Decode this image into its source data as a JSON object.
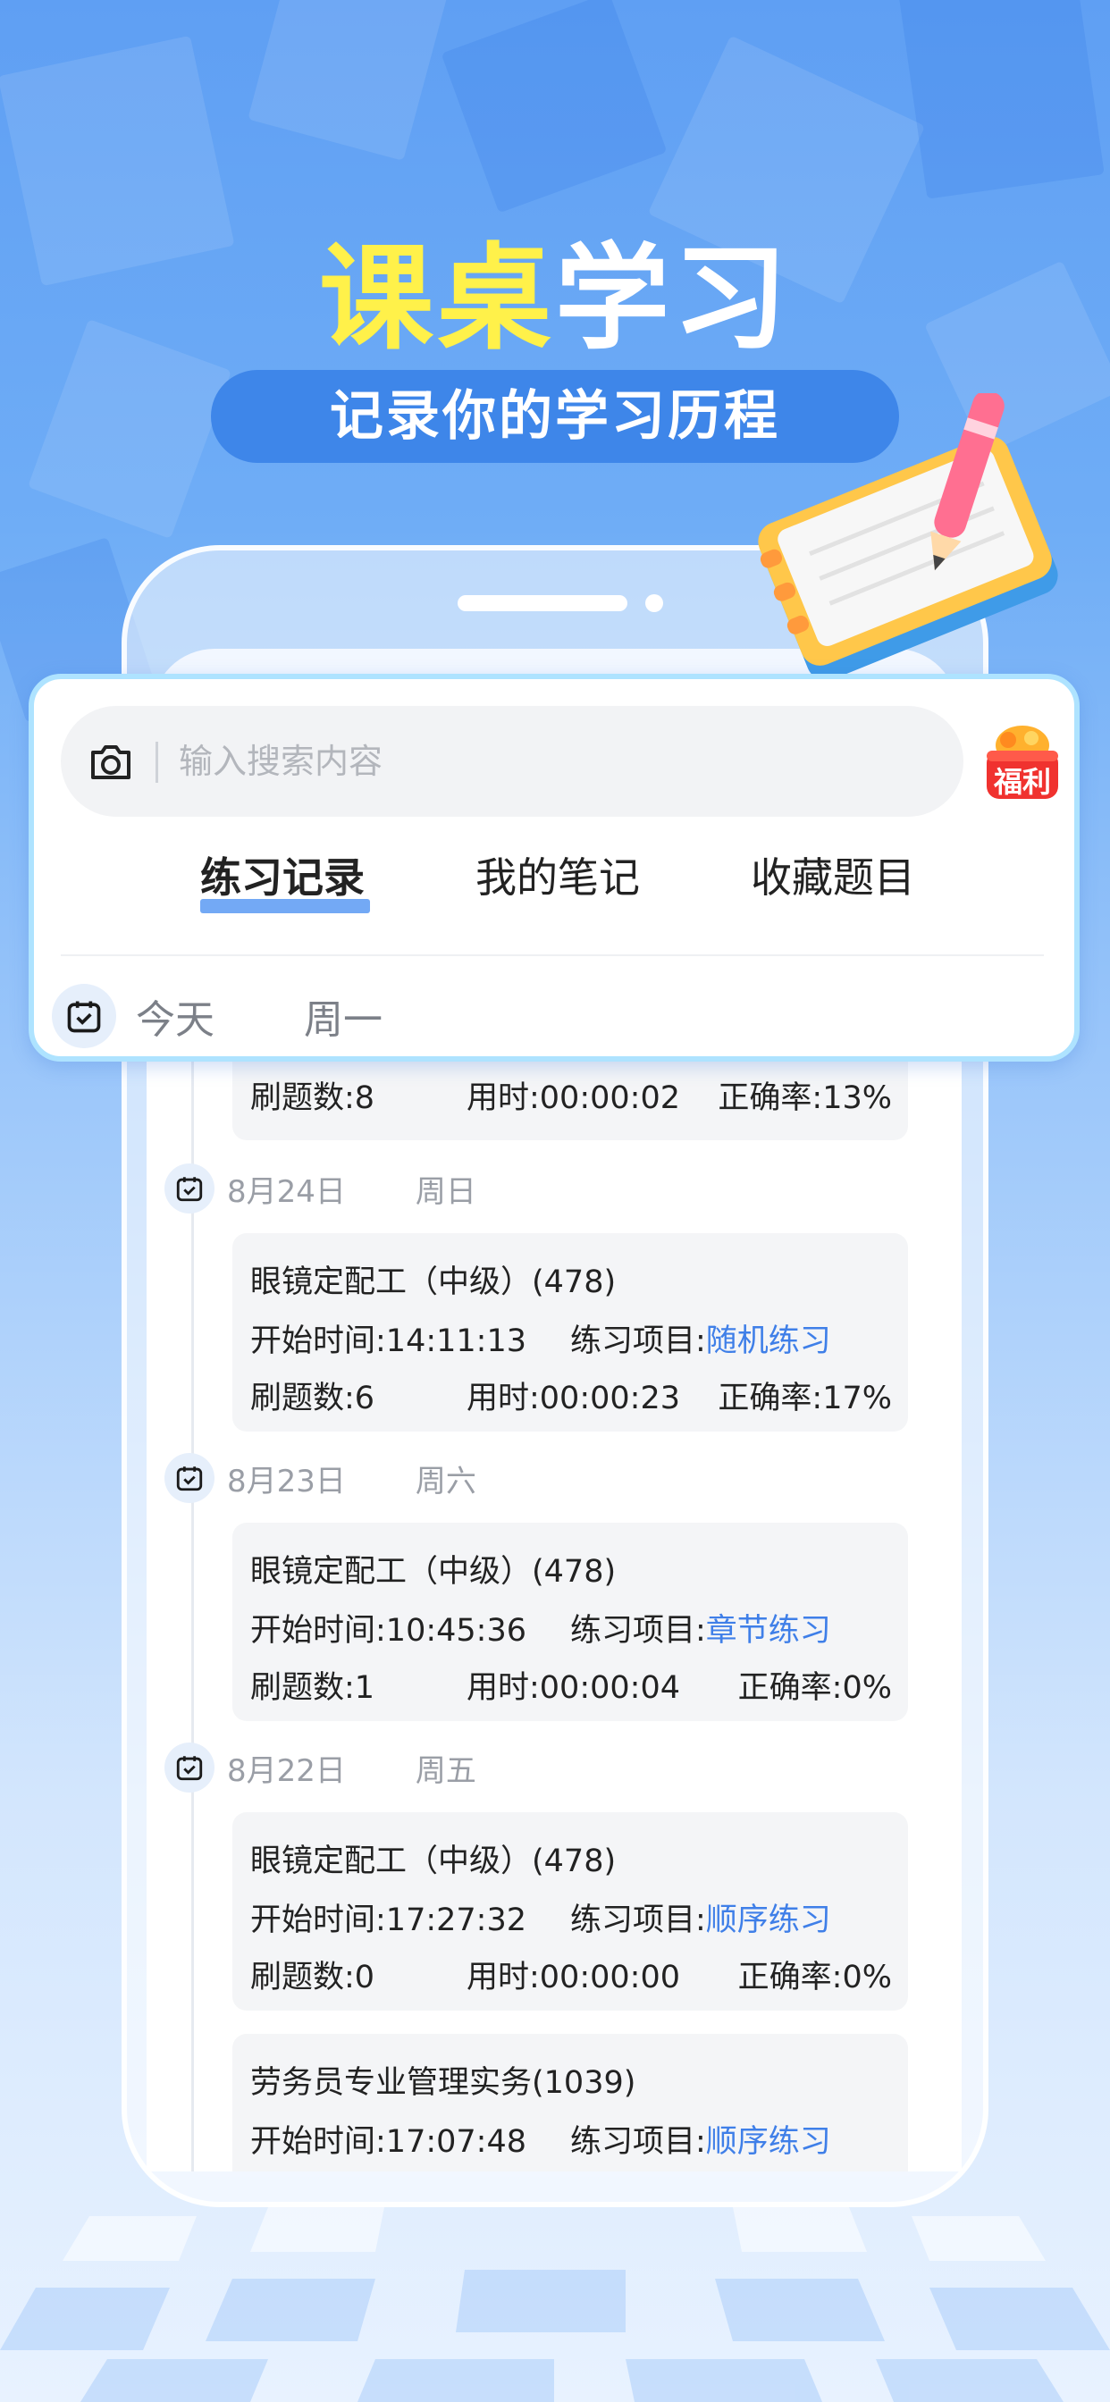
{
  "hero": {
    "title_yellow": "课桌",
    "title_white": "学习",
    "subtitle": "记录你的学习历程"
  },
  "search": {
    "placeholder": "输入搜索内容",
    "camera_icon": "camera-icon",
    "promo_label": "福利"
  },
  "tabs": [
    {
      "label": "练习记录",
      "active": true
    },
    {
      "label": "我的笔记",
      "active": false
    },
    {
      "label": "收藏题目",
      "active": false
    }
  ],
  "day_filter": {
    "today": "今天",
    "weekday": "周一"
  },
  "partial_record": {
    "count": "刷题数:8",
    "duration": "用时:00:00:02",
    "accuracy": "正确率:13%"
  },
  "groups": [
    {
      "date": "8月24日",
      "weekday": "周日",
      "records": [
        {
          "title": "眼镜定配工（中级）(478)",
          "start_label": "开始时间:",
          "start": "14:11:13",
          "item_label": "练习项目:",
          "item": "随机练习",
          "count": "刷题数:6",
          "duration": "用时:00:00:23",
          "accuracy": "正确率:17%"
        }
      ]
    },
    {
      "date": "8月23日",
      "weekday": "周六",
      "records": [
        {
          "title": "眼镜定配工（中级）(478)",
          "start_label": "开始时间:",
          "start": "10:45:36",
          "item_label": "练习项目:",
          "item": "章节练习",
          "count": "刷题数:1",
          "duration": "用时:00:00:04",
          "accuracy": "正确率:0%"
        }
      ]
    },
    {
      "date": "8月22日",
      "weekday": "周五",
      "records": [
        {
          "title": "眼镜定配工（中级）(478)",
          "start_label": "开始时间:",
          "start": "17:27:32",
          "item_label": "练习项目:",
          "item": "顺序练习",
          "count": "刷题数:0",
          "duration": "用时:00:00:00",
          "accuracy": "正确率:0%"
        },
        {
          "title": "劳务员专业管理实务(1039)",
          "start_label": "开始时间:",
          "start": "17:07:48",
          "item_label": "练习项目:",
          "item": "顺序练习"
        }
      ]
    }
  ],
  "colors": {
    "accent": "#3f7fe8",
    "title_yellow": "#fff14a",
    "pill": "#3e86e9"
  }
}
